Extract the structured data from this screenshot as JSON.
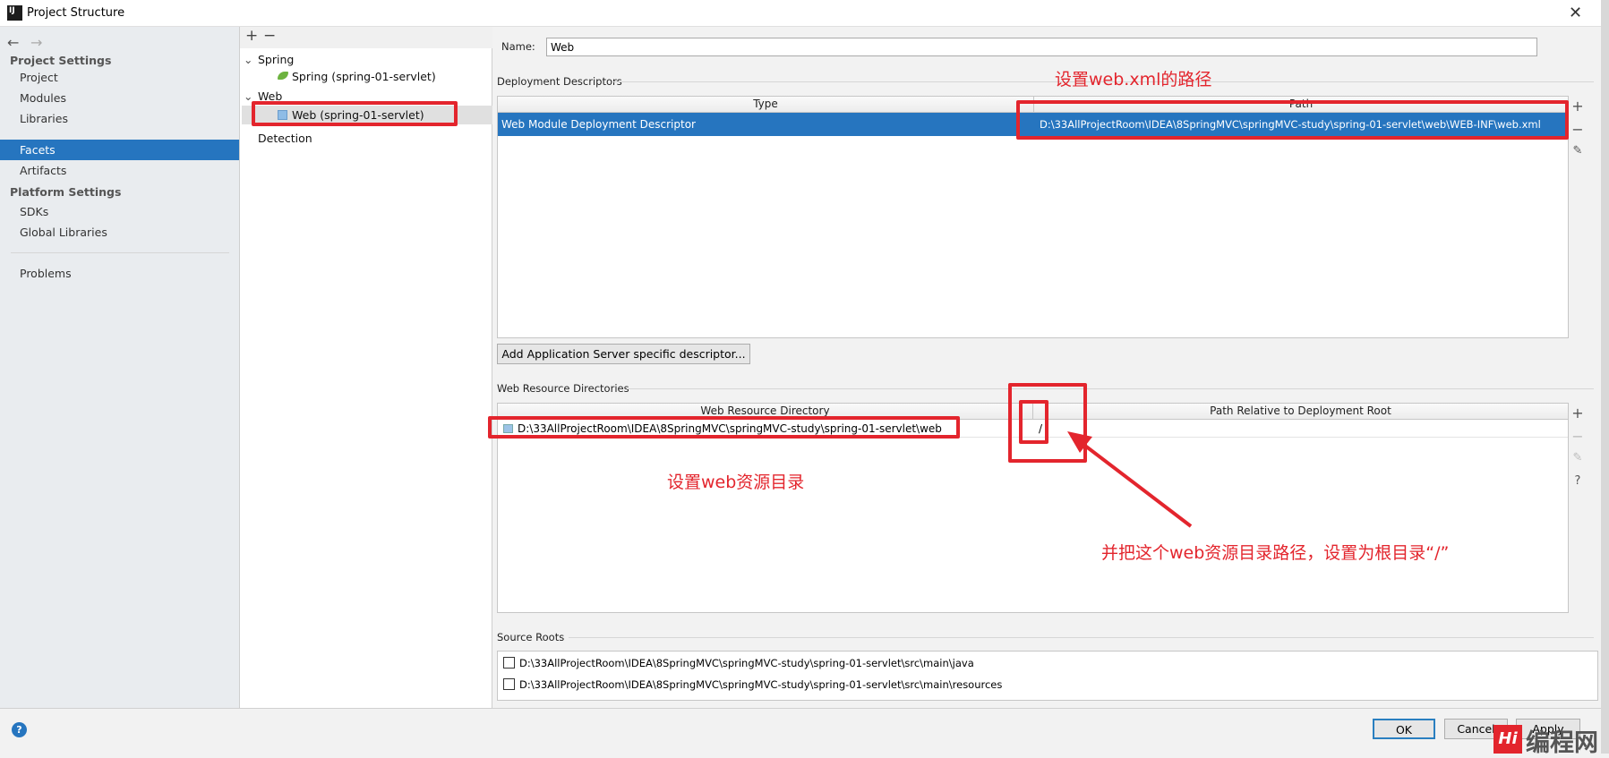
{
  "window": {
    "title": "Project Structure",
    "close_icon": "close-icon"
  },
  "sidebar": {
    "sections": [
      {
        "label": "Project Settings"
      },
      {
        "label": "Platform Settings"
      }
    ],
    "items": [
      {
        "label": "Project"
      },
      {
        "label": "Modules"
      },
      {
        "label": "Libraries"
      },
      {
        "label": "Facets",
        "selected": true
      },
      {
        "label": "Artifacts"
      },
      {
        "label": "SDKs"
      },
      {
        "label": "Global Libraries"
      },
      {
        "label": "Problems"
      }
    ]
  },
  "tree": {
    "add": "+",
    "remove": "−",
    "nodes": [
      {
        "label": "Spring"
      },
      {
        "label": "Spring (spring-01-servlet)"
      },
      {
        "label": "Web"
      },
      {
        "label": "Web (spring-01-servlet)",
        "selected": true
      },
      {
        "label": "Detection"
      }
    ]
  },
  "main": {
    "name_label": "Name:",
    "name_value": "Web",
    "deployment": {
      "title": "Deployment Descriptors",
      "columns": [
        "Type",
        "Path"
      ],
      "rows": [
        {
          "type": "Web Module Deployment Descriptor",
          "path": "D:\\33AllProjectRoom\\IDEA\\8SpringMVC\\springMVC-study\\spring-01-servlet\\web\\WEB-INF\\web.xml"
        }
      ],
      "add_server_button": "Add Application Server specific descriptor..."
    },
    "web_resources": {
      "title": "Web Resource Directories",
      "columns": [
        "Web Resource Directory",
        "Path Relative to Deployment Root"
      ],
      "rows": [
        {
          "dir": "D:\\33AllProjectRoom\\IDEA\\8SpringMVC\\springMVC-study\\spring-01-servlet\\web",
          "relative": "/"
        }
      ],
      "help": "?"
    },
    "source_roots": {
      "title": "Source Roots",
      "items": [
        {
          "path": "D:\\33AllProjectRoom\\IDEA\\8SpringMVC\\springMVC-study\\spring-01-servlet\\src\\main\\java",
          "checked": false
        },
        {
          "path": "D:\\33AllProjectRoom\\IDEA\\8SpringMVC\\springMVC-study\\spring-01-servlet\\src\\main\\resources",
          "checked": false
        }
      ]
    }
  },
  "footer": {
    "ok": "OK",
    "cancel": "Cancel",
    "apply": "Apply",
    "help": "?"
  },
  "annotations": {
    "xml_path": "设置web.xml的路径",
    "web_dir": "设置web资源目录",
    "root": "并把这个web资源目录路径，设置为根目录“/”",
    "color": "#e3252d"
  },
  "watermark": {
    "logo": "编程网"
  },
  "colors": {
    "selection": "#2675bf"
  }
}
